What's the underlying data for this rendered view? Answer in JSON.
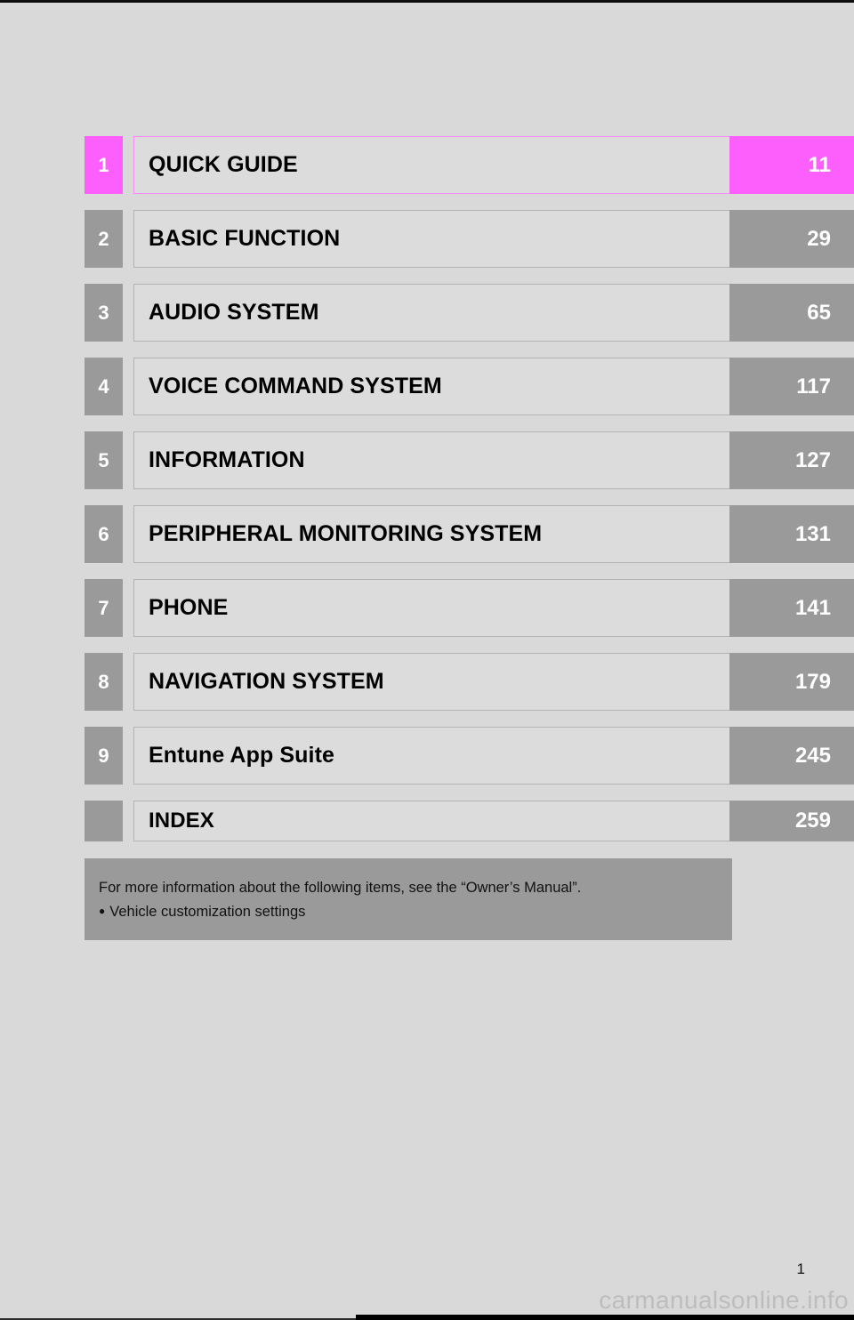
{
  "document": {
    "type": "table-of-contents",
    "folio": "1",
    "watermark": "carmanualsonline.info"
  },
  "toc": {
    "rows": [
      {
        "number": "1",
        "title": "QUICK GUIDE",
        "page": "11",
        "highlight": true
      },
      {
        "number": "2",
        "title": "BASIC FUNCTION",
        "page": "29",
        "highlight": false
      },
      {
        "number": "3",
        "title": "AUDIO SYSTEM",
        "page": "65",
        "highlight": false
      },
      {
        "number": "4",
        "title": "VOICE COMMAND SYSTEM",
        "page": "117",
        "highlight": false
      },
      {
        "number": "5",
        "title": "INFORMATION",
        "page": "127",
        "highlight": false
      },
      {
        "number": "6",
        "title": "PERIPHERAL MONITORING SYSTEM",
        "page": "131",
        "highlight": false
      },
      {
        "number": "7",
        "title": "PHONE",
        "page": "141",
        "highlight": false
      },
      {
        "number": "8",
        "title": "NAVIGATION SYSTEM",
        "page": "179",
        "highlight": false
      },
      {
        "number": "9",
        "title": "Entune App Suite",
        "page": "245",
        "highlight": false
      },
      {
        "number": "",
        "title": "INDEX",
        "page": "259",
        "highlight": false
      }
    ]
  },
  "note": {
    "heading": "For more information about the following items, see the “Owner’s Manual”.",
    "bullet_glyph": "●",
    "items": [
      "Vehicle customization settings"
    ]
  },
  "colors": {
    "page_background": "#d9d9d9",
    "title_box": "#dcdcdc",
    "gray_accent": "#9a9a9a",
    "highlight_magenta": "#fc5ffc",
    "note_background": "#9a9a9a",
    "text": "#000000",
    "watermark": "#bdbdbd"
  }
}
